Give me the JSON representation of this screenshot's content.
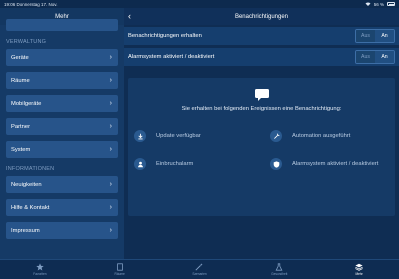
{
  "status_bar": {
    "time": "19:06",
    "date": "Donnerstag 17. Nov.",
    "battery": "56 %"
  },
  "sidebar": {
    "title": "Mehr",
    "sections": [
      {
        "label": "VERWALTUNG",
        "items": [
          "Geräte",
          "Räume",
          "Mobilgeräte",
          "Partner",
          "System"
        ]
      },
      {
        "label": "INFORMATIONEN",
        "items": [
          "Neuigkeiten",
          "Hilfe & Kontakt",
          "Impressum"
        ]
      }
    ]
  },
  "main": {
    "title": "Benachrichtigungen",
    "settings": [
      {
        "label": "Benachrichtigungen erhalten",
        "off": "Aus",
        "on": "An",
        "value": "An"
      },
      {
        "label": "Alarmsystem aktiviert / deaktiviert",
        "off": "Aus",
        "on": "An",
        "value": "An"
      }
    ],
    "info_text": "Sie erhalten bei folgenden Ereignissen eine Benachrichtigung:",
    "events": [
      {
        "label": "Update verfügbar",
        "icon": "download-icon"
      },
      {
        "label": "Automation ausgeführt",
        "icon": "automation-icon"
      },
      {
        "label": "Einbruchalarm",
        "icon": "burglar-alarm-icon"
      },
      {
        "label": "Alarmsystem aktiviert / deaktiviert",
        "icon": "shield-icon"
      }
    ]
  },
  "tab_bar": {
    "items": [
      {
        "label": "Favoriten",
        "icon": "star-icon",
        "active": false
      },
      {
        "label": "Räume",
        "icon": "room-icon",
        "active": false
      },
      {
        "label": "Szenarien",
        "icon": "magic-wand-icon",
        "active": false
      },
      {
        "label": "Gesundheit",
        "icon": "flask-icon",
        "active": false
      },
      {
        "label": "Mehr",
        "icon": "layers-icon",
        "active": true
      }
    ]
  },
  "colors": {
    "background": "#0f2e55",
    "card": "#27548a",
    "accent": "#ffffff"
  }
}
